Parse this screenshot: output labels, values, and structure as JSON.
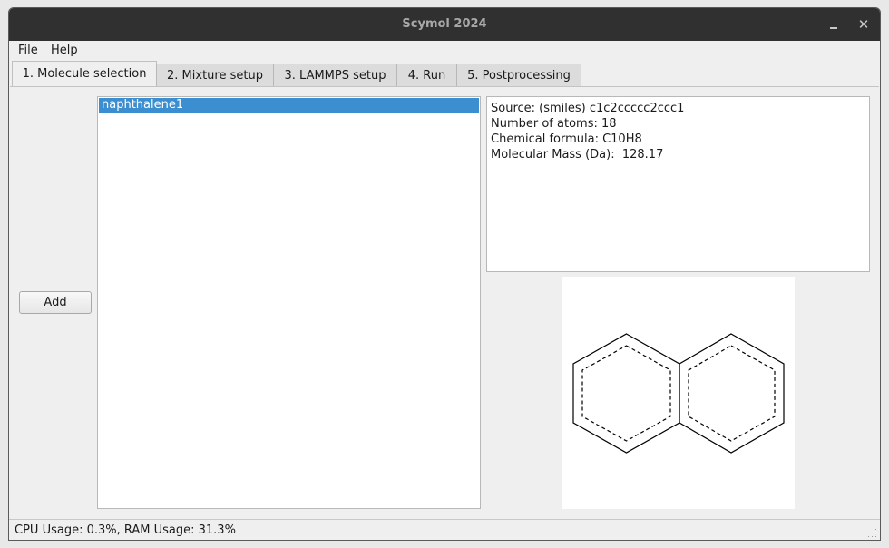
{
  "window": {
    "title": "Scymol 2024"
  },
  "menu": {
    "file": "File",
    "help": "Help"
  },
  "tabs": [
    {
      "label": "1. Molecule selection"
    },
    {
      "label": "2. Mixture setup"
    },
    {
      "label": "3. LAMMPS setup"
    },
    {
      "label": "4. Run"
    },
    {
      "label": "5. Postprocessing"
    }
  ],
  "active_tab": 0,
  "add_button": "Add",
  "molecules": [
    {
      "name": "naphthalene1",
      "selected": true
    }
  ],
  "info": {
    "source": "Source: (smiles) c1c2ccccc2ccc1",
    "atoms": "Number of atoms: 18",
    "formula": "Chemical formula: C10H8",
    "mass": "Molecular Mass (Da):  128.17"
  },
  "structure_image": {
    "molecule": "naphthalene",
    "bond_color": "#000000"
  },
  "status": "CPU Usage: 0.3%, RAM Usage: 31.3%",
  "colors": {
    "selection": "#3b8ed0",
    "titlebar": "#303030"
  }
}
